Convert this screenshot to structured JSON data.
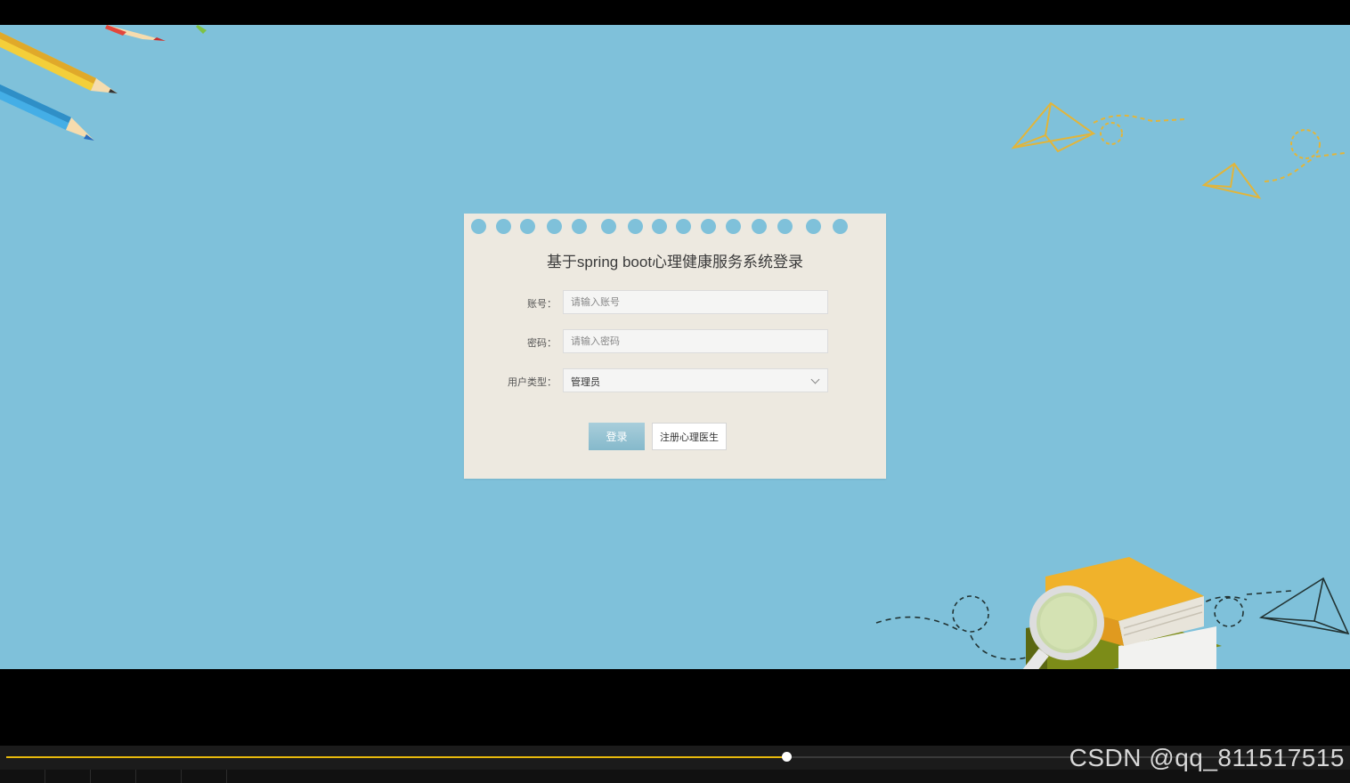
{
  "login": {
    "title": "基于spring boot心理健康服务系统登录",
    "account_label": "账号：",
    "account_placeholder": "请输入账号",
    "password_label": "密码：",
    "password_placeholder": "请输入密码",
    "user_type_label": "用户类型：",
    "user_type_value": "管理员",
    "login_button": "登录",
    "register_button": "注册心理医生"
  },
  "player": {
    "progress_fraction": 0.584,
    "watermark": "CSDN @qq_811517515"
  },
  "colors": {
    "background": "#7fc1da",
    "card": "#ede9e0",
    "progress": "#e7b90c"
  }
}
